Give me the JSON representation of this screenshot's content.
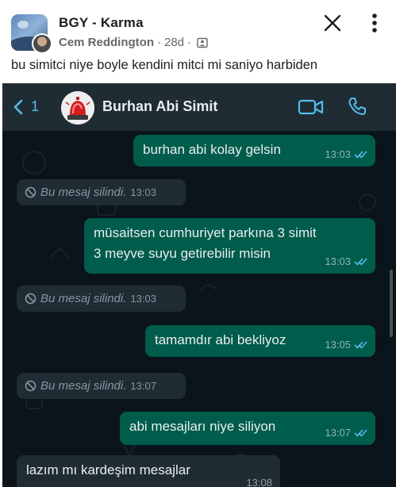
{
  "post": {
    "group_name": "BGY - Karma",
    "author": "Cem Reddington",
    "separator": "·",
    "time_ago": "28d",
    "separator2": "·",
    "audience_icon": "group-icon",
    "text": "bu simitci niye boyle kendini mitci mi saniyo harbiden",
    "close_icon": "close-icon",
    "more_icon": "more-vertical-icon"
  },
  "whatsapp": {
    "back_count": "1",
    "contact_name": "Burhan Abi Simit",
    "accent_color": "#53bdeb",
    "outgoing_color": "#005c4b",
    "incoming_color": "#202c33",
    "messages": [
      {
        "direction": "out",
        "text": "burhan abi kolay gelsin",
        "time": "13:03",
        "status": "read"
      },
      {
        "direction": "in",
        "deleted": true,
        "text": "Bu mesaj silindi.",
        "time": "13:03"
      },
      {
        "direction": "out",
        "lines": [
          "müsaitsen cumhuriyet parkına 3 simit",
          "3 meyve suyu getirebilir misin"
        ],
        "time": "13:03",
        "status": "read"
      },
      {
        "direction": "in",
        "deleted": true,
        "text": "Bu mesaj silindi.",
        "time": "13:03"
      },
      {
        "direction": "out",
        "text": "tamamdır abi bekliyoz",
        "time": "13:05",
        "status": "read"
      },
      {
        "direction": "in",
        "deleted": true,
        "text": "Bu mesaj silindi.",
        "time": "13:07"
      },
      {
        "direction": "out",
        "text": "abi mesajları niye siliyon",
        "time": "13:07",
        "status": "read"
      },
      {
        "direction": "in",
        "text": "lazım mı kardeşim mesajlar",
        "time": "13:08"
      }
    ]
  }
}
